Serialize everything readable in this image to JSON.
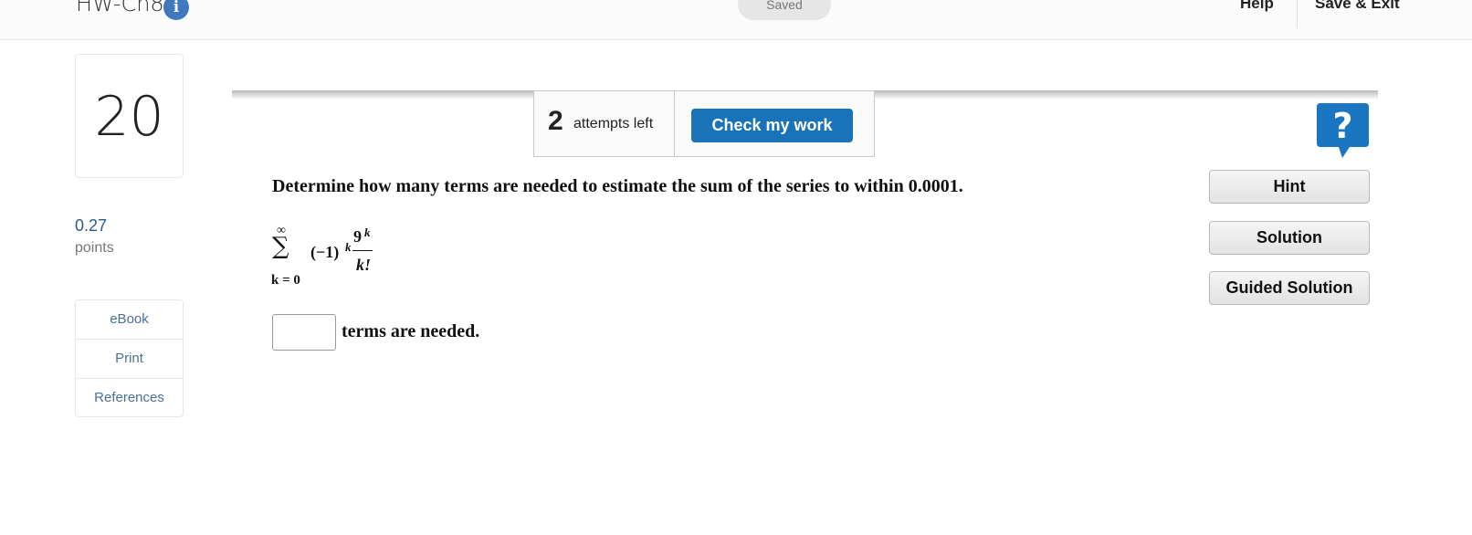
{
  "header": {
    "assignment_title": "HW-Ch8",
    "info_badge": "i",
    "saved_label": "Saved",
    "help_label": "Help",
    "save_exit_label": "Save & Exit"
  },
  "sidebar": {
    "question_number": "20",
    "points_value": "0.27",
    "points_label": "points",
    "resources": [
      {
        "label": "eBook"
      },
      {
        "label": "Print"
      },
      {
        "label": "References"
      }
    ]
  },
  "toolbar": {
    "attempts_count": "2",
    "attempts_label": "attempts left",
    "check_label": "Check my work",
    "help_icon": "question-mark-icon",
    "accent_color": "#1a73b8"
  },
  "side_buttons": {
    "hint": "Hint",
    "solution": "Solution",
    "guided_solution": "Guided Solution"
  },
  "question": {
    "prompt": "Determine how many terms are needed to estimate the sum of the series to within 0.0001.",
    "series": {
      "upper_limit": "∞",
      "sigma": "∑",
      "lower_limit": "k = 0",
      "sign_term": "(−1)",
      "sign_exponent": "k",
      "numerator_base": "9",
      "numerator_exponent": "k",
      "denominator": "k!"
    },
    "answer_value": "",
    "answer_suffix": "terms are needed."
  }
}
